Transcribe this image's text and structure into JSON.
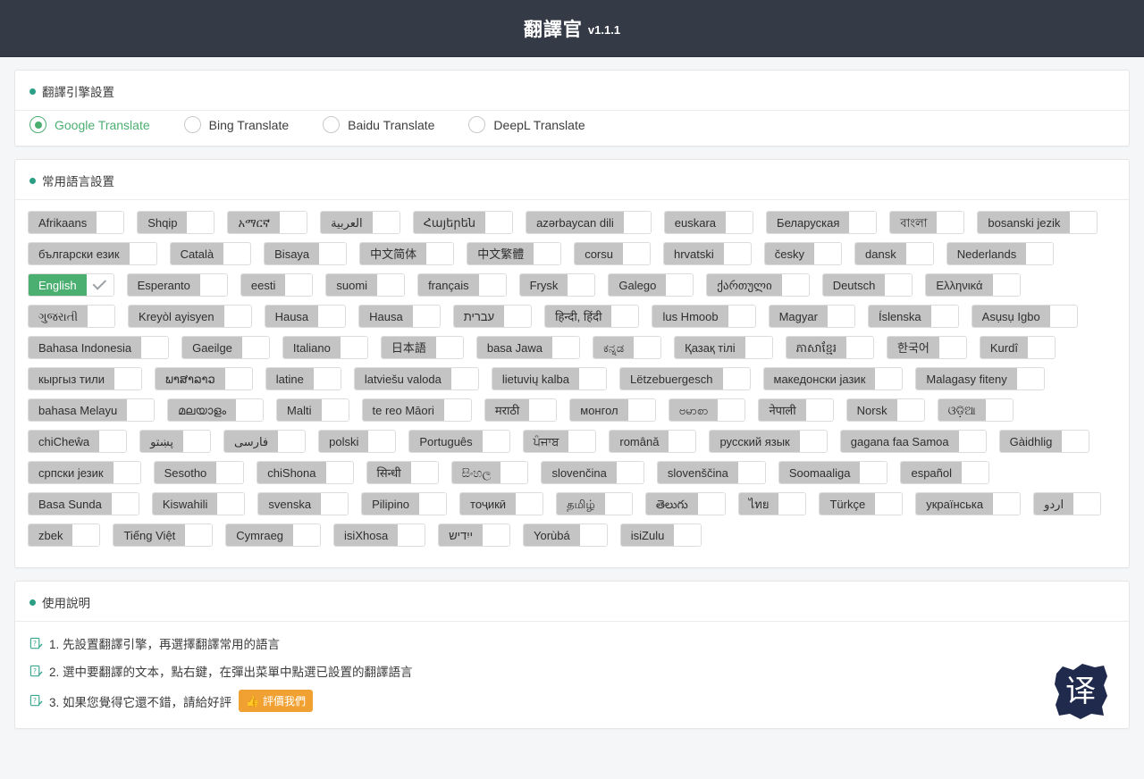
{
  "header": {
    "title": "翻譯官",
    "version": "v1.1.1"
  },
  "colors": {
    "header_bg": "#343a46",
    "accent_green": "#4caf72",
    "dot_teal": "#2b9e86",
    "chip_gray": "#c4c4c4",
    "rate_orange": "#f0a132",
    "page_bg": "#f5f6f7"
  },
  "engine_section": {
    "title": "翻譯引擎設置",
    "dot_icon": "bullet-dot-icon",
    "selected": "Google Translate",
    "options": [
      {
        "label": "Google Translate",
        "selected": true
      },
      {
        "label": "Bing Translate",
        "selected": false
      },
      {
        "label": "Baidu Translate",
        "selected": false
      },
      {
        "label": "DeepL Translate",
        "selected": false
      }
    ]
  },
  "language_section": {
    "title": "常用語言設置",
    "dot_icon": "bullet-dot-icon",
    "check_icon": "check-icon",
    "languages": [
      {
        "label": "Afrikaans",
        "selected": false
      },
      {
        "label": "Shqip",
        "selected": false
      },
      {
        "label": "አማርኛ",
        "selected": false
      },
      {
        "label": "العربية",
        "selected": false
      },
      {
        "label": "Հայերեն",
        "selected": false
      },
      {
        "label": "azərbaycan dili",
        "selected": false
      },
      {
        "label": "euskara",
        "selected": false
      },
      {
        "label": "Беларуская",
        "selected": false
      },
      {
        "label": "বাংলা",
        "selected": false
      },
      {
        "label": "bosanski jezik",
        "selected": false
      },
      {
        "label": "български език",
        "selected": false
      },
      {
        "label": "Català",
        "selected": false
      },
      {
        "label": "Bisaya",
        "selected": false
      },
      {
        "label": "中文简体",
        "selected": false
      },
      {
        "label": "中文繁體",
        "selected": false
      },
      {
        "label": "corsu",
        "selected": false
      },
      {
        "label": "hrvatski",
        "selected": false
      },
      {
        "label": "česky",
        "selected": false
      },
      {
        "label": "dansk",
        "selected": false
      },
      {
        "label": "Nederlands",
        "selected": false
      },
      {
        "label": "English",
        "selected": true
      },
      {
        "label": "Esperanto",
        "selected": false
      },
      {
        "label": "eesti",
        "selected": false
      },
      {
        "label": "suomi",
        "selected": false
      },
      {
        "label": "français",
        "selected": false
      },
      {
        "label": "Frysk",
        "selected": false
      },
      {
        "label": "Galego",
        "selected": false
      },
      {
        "label": "ქართული",
        "selected": false
      },
      {
        "label": "Deutsch",
        "selected": false
      },
      {
        "label": "Ελληνικά",
        "selected": false
      },
      {
        "label": "ગુજરાતી",
        "selected": false
      },
      {
        "label": "Kreyòl ayisyen",
        "selected": false
      },
      {
        "label": "Hausa",
        "selected": false
      },
      {
        "label": "Hausa",
        "selected": false
      },
      {
        "label": "עברית",
        "selected": false
      },
      {
        "label": "हिन्दी, हिंदी",
        "selected": false
      },
      {
        "label": "lus Hmoob",
        "selected": false
      },
      {
        "label": "Magyar",
        "selected": false
      },
      {
        "label": "Íslenska",
        "selected": false
      },
      {
        "label": "Asụsụ Igbo",
        "selected": false
      },
      {
        "label": "Bahasa Indonesia",
        "selected": false
      },
      {
        "label": "Gaeilge",
        "selected": false
      },
      {
        "label": "Italiano",
        "selected": false
      },
      {
        "label": "日本語",
        "selected": false
      },
      {
        "label": "basa Jawa",
        "selected": false
      },
      {
        "label": "ಕನ್ನಡ",
        "selected": false
      },
      {
        "label": "Қазақ тілі",
        "selected": false
      },
      {
        "label": "ភាសាខ្មែរ",
        "selected": false
      },
      {
        "label": "한국어",
        "selected": false
      },
      {
        "label": "Kurdî",
        "selected": false
      },
      {
        "label": "кыргыз тили",
        "selected": false
      },
      {
        "label": "ພາສາລາວ",
        "selected": false
      },
      {
        "label": "latine",
        "selected": false
      },
      {
        "label": "latviešu valoda",
        "selected": false
      },
      {
        "label": "lietuvių kalba",
        "selected": false
      },
      {
        "label": "Lëtzebuergesch",
        "selected": false
      },
      {
        "label": "македонски јазик",
        "selected": false
      },
      {
        "label": "Malagasy fiteny",
        "selected": false
      },
      {
        "label": "bahasa Melayu",
        "selected": false
      },
      {
        "label": "മലയാളം",
        "selected": false
      },
      {
        "label": "Malti",
        "selected": false
      },
      {
        "label": "te reo Māori",
        "selected": false
      },
      {
        "label": "मराठी",
        "selected": false
      },
      {
        "label": "монгол",
        "selected": false
      },
      {
        "label": "ဗမာစာ",
        "selected": false
      },
      {
        "label": "नेपाली",
        "selected": false
      },
      {
        "label": "Norsk",
        "selected": false
      },
      {
        "label": "ଓଡ଼ିଆ",
        "selected": false
      },
      {
        "label": "chiCheŵa",
        "selected": false
      },
      {
        "label": "پښتو",
        "selected": false
      },
      {
        "label": "فارسی",
        "selected": false
      },
      {
        "label": "polski",
        "selected": false
      },
      {
        "label": "Português",
        "selected": false
      },
      {
        "label": "ਪੰਜਾਬ",
        "selected": false
      },
      {
        "label": "română",
        "selected": false
      },
      {
        "label": "русский язык",
        "selected": false
      },
      {
        "label": "gagana faa Samoa",
        "selected": false
      },
      {
        "label": "Gàidhlig",
        "selected": false
      },
      {
        "label": "српски језик",
        "selected": false
      },
      {
        "label": "Sesotho",
        "selected": false
      },
      {
        "label": "chiShona",
        "selected": false
      },
      {
        "label": "सिन्धी",
        "selected": false
      },
      {
        "label": "සිංහල",
        "selected": false
      },
      {
        "label": "slovenčina",
        "selected": false
      },
      {
        "label": "slovenščina",
        "selected": false
      },
      {
        "label": "Soomaaliga",
        "selected": false
      },
      {
        "label": "español",
        "selected": false
      },
      {
        "label": "Basa Sunda",
        "selected": false
      },
      {
        "label": "Kiswahili",
        "selected": false
      },
      {
        "label": "svenska",
        "selected": false
      },
      {
        "label": "Pilipino",
        "selected": false
      },
      {
        "label": "тоҷикӣ",
        "selected": false
      },
      {
        "label": "தமிழ்",
        "selected": false
      },
      {
        "label": "తెలుగు",
        "selected": false
      },
      {
        "label": "ไทย",
        "selected": false
      },
      {
        "label": "Türkçe",
        "selected": false
      },
      {
        "label": "українська",
        "selected": false
      },
      {
        "label": "اردو",
        "selected": false
      },
      {
        "label": "zbek",
        "selected": false
      },
      {
        "label": "Tiếng Việt",
        "selected": false
      },
      {
        "label": "Cymraeg",
        "selected": false
      },
      {
        "label": "isiXhosa",
        "selected": false
      },
      {
        "label": "ייִדיש",
        "selected": false
      },
      {
        "label": "Yorùbá",
        "selected": false
      },
      {
        "label": "isiZulu",
        "selected": false
      }
    ]
  },
  "help_section": {
    "title": "使用說明",
    "dot_icon": "bullet-dot-icon",
    "note_icon": "note-pencil-icon",
    "lines": [
      "1. 先設置翻譯引擎，再選擇翻譯常用的語言",
      "2. 選中要翻譯的文本，點右鍵，在彈出菜單中點選已設置的翻譯語言",
      "3. 如果您覺得它還不錯，請給好評"
    ],
    "rate_button": {
      "label": "評價我們",
      "icon": "thumbs-up-icon"
    },
    "logo": {
      "name": "translate-brush-logo",
      "character": "译"
    }
  }
}
